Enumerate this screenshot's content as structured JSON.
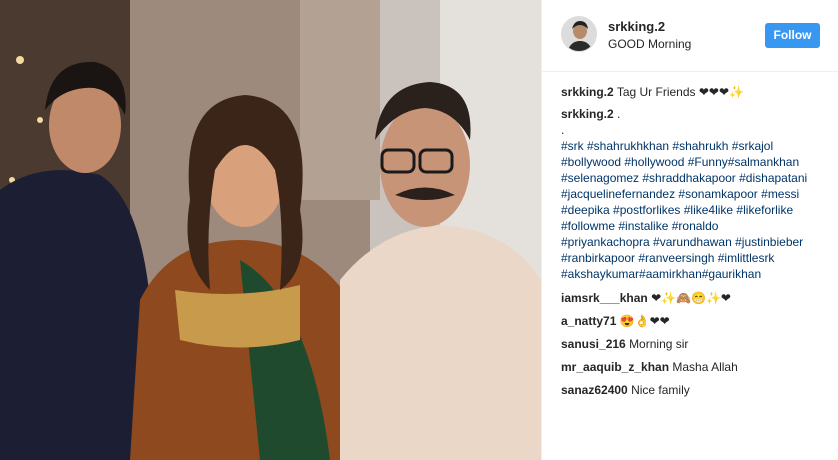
{
  "post": {
    "username": "srkking.2",
    "location": "GOOD Morning",
    "follow_label": "Follow"
  },
  "caption": {
    "username": "srkking.2",
    "text": "Tag Ur Friends ❤❤❤✨"
  },
  "second_comment": {
    "username": "srkking.2",
    "text": ".",
    "dot_line": ".",
    "hashtag_lines": [
      "#srk #shahrukhkhan #shahrukh #srkajol",
      "#bollywood #hollywood #Funny#salmankhan",
      "#selenagomez #shraddhakapoor #dishapatani",
      "#jacquelinefernandez #sonamkapoor #messi",
      "#deepika #postforlikes #like4like #likeforlike",
      "#followme #instalike #ronaldo",
      "#priyankachopra #varundhawan #justinbieber",
      "#ranbirkapoor #ranveersingh #imlittlesrk",
      "#akshaykumar#aamirkhan#gaurikhan"
    ]
  },
  "comments": [
    {
      "username": "iamsrk___khan",
      "text": "❤✨🙈😁✨❤"
    },
    {
      "username": "a_natty71",
      "text": "😍👌❤❤"
    },
    {
      "username": "sanusi_216",
      "text": "Morning sir"
    },
    {
      "username": "mr_aaquib_z_khan",
      "text": "Masha Allah"
    },
    {
      "username": "sanaz62400",
      "text": "Nice family"
    }
  ],
  "colors": {
    "follow_bg": "#3897f0",
    "hashtag": "#003569",
    "text": "#262626"
  }
}
